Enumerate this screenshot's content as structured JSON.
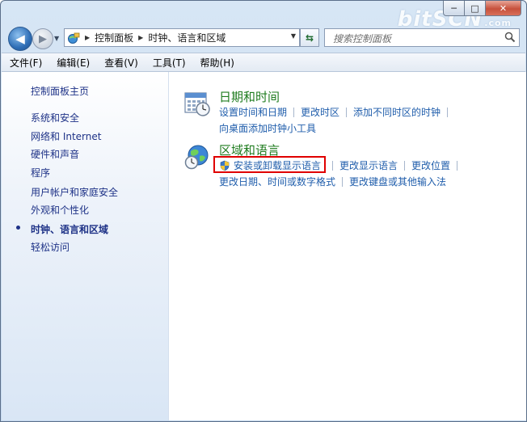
{
  "window": {
    "watermark": "bitSCN",
    "watermark_sub": ".com",
    "buttons": {
      "min": "─",
      "max": "□",
      "close": "✕"
    }
  },
  "nav": {
    "back_icon": "arrow-left-icon",
    "forward_icon": "arrow-right-icon",
    "breadcrumb": [
      "控制面板",
      "时钟、语言和区域"
    ],
    "search_placeholder": "搜索控制面板"
  },
  "menu": {
    "items": [
      "文件(F)",
      "编辑(E)",
      "查看(V)",
      "工具(T)",
      "帮助(H)"
    ]
  },
  "sidebar": {
    "home": "控制面板主页",
    "items": [
      "系统和安全",
      "网络和 Internet",
      "硬件和声音",
      "程序",
      "用户帐户和家庭安全",
      "外观和个性化",
      "时钟、语言和区域",
      "轻松访问"
    ],
    "current_index": 6
  },
  "categories": [
    {
      "title": "日期和时间",
      "icon": "calendar-clock-icon",
      "row1": [
        "设置时间和日期",
        "更改时区",
        "添加不同时区的时钟"
      ],
      "row2": [
        "向桌面添加时钟小工具"
      ]
    },
    {
      "title": "区域和语言",
      "icon": "globe-clock-icon",
      "row1": [
        "安装或卸载显示语言",
        "更改显示语言",
        "更改位置"
      ],
      "row2": [
        "更改日期、时间或数字格式",
        "更改键盘或其他输入法"
      ]
    }
  ],
  "colors": {
    "link": "#1f5dab",
    "category_title": "#1f7c1f",
    "sidebar_link": "#1e3287",
    "highlight": "#e00000"
  }
}
